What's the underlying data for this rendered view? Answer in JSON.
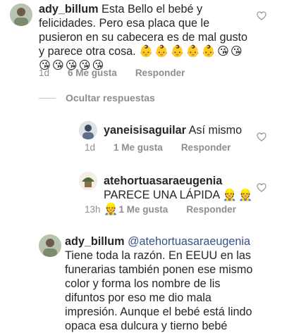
{
  "comments": [
    {
      "username": "ady_billum",
      "text": " Esta Bello el bebé y felicidades. Pero esa placa que le pusieron en su cabecera es de mal gusto y parece otra cosa.",
      "emojis": "👶👶👶👶👶😘😘😘😘😘😘😘",
      "time": "1d",
      "likes": "6 Me gusta",
      "reply_label": "Responder"
    },
    {
      "username": "yaneisisaguilar",
      "text": " Así mismo",
      "time": "1d",
      "likes": "1 Me gusta",
      "reply_label": "Responder"
    },
    {
      "username": "atehortuasaraeugenia",
      "text": " PARECE UNA LÁPIDA ",
      "emojis": "👷👷👷",
      "time": "13h",
      "likes": "1 Me gusta",
      "reply_label": "Responder"
    },
    {
      "username": "ady_billum",
      "mention": "@atehortuasaraeugenia",
      "text": "Tiene toda la razón. En EEUU en las funerarias también ponen ese mismo color y forma los nombre de lis difuntos por eso me dio mala impresión. Aunque el bebé está lindo opaca esa dulcura y tierno bebé"
    }
  ],
  "replies_toggle": "Ocultar respuestas",
  "icons": {
    "like": "heart-outline-icon"
  },
  "colors": {
    "meta": "#8e8e8e",
    "mention": "#385185",
    "text": "#262626"
  }
}
